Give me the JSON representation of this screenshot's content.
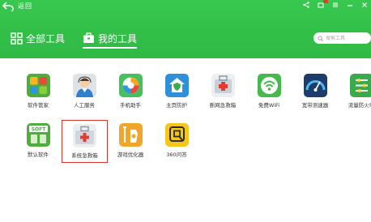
{
  "header": {
    "back_label": "返回"
  },
  "nav": {
    "tabs": [
      {
        "label": "全部工具"
      },
      {
        "label": "我的工具"
      }
    ]
  },
  "search": {
    "placeholder": "搜索工具"
  },
  "tools": [
    {
      "label": "软件管家",
      "icon": "software-manager-icon"
    },
    {
      "label": "人工服务",
      "icon": "human-service-icon"
    },
    {
      "label": "手机助手",
      "icon": "mobile-assistant-icon"
    },
    {
      "label": "主页防护",
      "icon": "homepage-protection-icon"
    },
    {
      "label": "断网急救箱",
      "icon": "network-first-aid-icon"
    },
    {
      "label": "免费WiFi",
      "icon": "free-wifi-icon"
    },
    {
      "label": "宽带测速器",
      "icon": "broadband-speed-icon"
    },
    {
      "label": "流量防火墙",
      "icon": "traffic-firewall-icon"
    },
    {
      "label": "默认软件",
      "icon": "default-software-icon"
    },
    {
      "label": "系统急救箱",
      "icon": "system-first-aid-icon"
    },
    {
      "label": "游戏优化器",
      "icon": "game-optimizer-icon"
    },
    {
      "label": "360问答",
      "icon": "qa-icon"
    }
  ],
  "colors": {
    "header_green": "#2eb944",
    "selection_red": "#d9352c"
  }
}
